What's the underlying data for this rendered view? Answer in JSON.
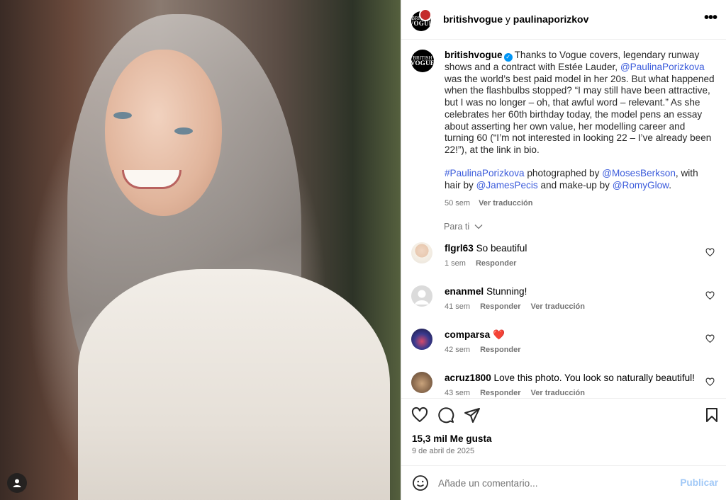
{
  "post": {
    "header": {
      "account1": "britishvogue",
      "joiner": "y",
      "account2": "paulinaporizkov"
    },
    "avatar_text": {
      "line1": "BRITISH",
      "line2": "VOGUE"
    },
    "caption": {
      "author": "britishvogue",
      "p1a": "Thanks to Vogue covers, legendary runway shows and a contract with Estée Lauder, ",
      "mention1": "@PaulinaPorizkova",
      "p1b": " was the world’s best paid model in her 20s. But what happened when the flashbulbs stopped? “I may still have been attractive, but I was no longer – oh, that awful word – relevant.” As she celebrates her 60th birthday today, the model pens an essay about asserting her own value, her modelling career and turning 60 (“I’m not interested in looking 22 – I’ve already been 22!”), at the link in bio.",
      "hashtag": "#PaulinaPorizkova",
      "p2a": " photographed by ",
      "mention2": "@MosesBerkson",
      "p2b": ", with hair by ",
      "mention3": "@JamesPecis",
      "p2c": " and make-up by ",
      "mention4": "@RomyGlow",
      "p2d": ".",
      "time": "50 sem",
      "translate": "Ver traducción"
    },
    "filter_label": "Para ti",
    "comments": [
      {
        "user": "flgrl63",
        "text": "So beautiful",
        "time": "1 sem",
        "reply": "Responder",
        "translate": ""
      },
      {
        "user": "enanmel",
        "text": "Stunning!",
        "time": "41 sem",
        "reply": "Responder",
        "translate": "Ver traducción"
      },
      {
        "user": "comparsa",
        "text": "❤️",
        "time": "42 sem",
        "reply": "Responder",
        "translate": ""
      },
      {
        "user": "acruz1800",
        "text": "Love this photo. You look so naturally beautiful!",
        "time": "43 sem",
        "reply": "Responder",
        "translate": "Ver traducción"
      }
    ],
    "likes": "15,3 mil Me gusta",
    "date": "9 de abril de 2025",
    "compose": {
      "placeholder": "Añade un comentario...",
      "publish": "Publicar"
    },
    "icons": [
      "heart-icon",
      "comment-icon",
      "share-icon",
      "bookmark-icon",
      "emoji-icon",
      "more-icon",
      "user-tag-icon"
    ],
    "colors": {
      "link": "#3b5bdb",
      "verified": "#0095f6",
      "publish_disabled": "#a0c8f7",
      "heart_emoji": "#e0245e"
    }
  }
}
